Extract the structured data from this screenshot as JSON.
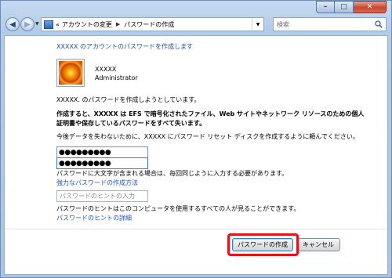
{
  "nav": {
    "breadcrumb_prefix": "«",
    "crumbs": [
      "アカウントの変更",
      "パスワードの作成"
    ],
    "search_placeholder": "検索"
  },
  "window_controls": {
    "minimize": "–",
    "maximize": "□",
    "close": "✕"
  },
  "content": {
    "title": "XXXXX のアカウントのパスワードを作成します",
    "user": {
      "name": "XXXXX",
      "role": "Administrator"
    },
    "intro": "XXXXX. のパスワードを作成しようとしています。",
    "warning": "作成すると、XXXXX は EFS で暗号化されたファイル、Web サイトやネットワーク リソースのための個人証明書や保存しているパスワードをすべて失います。",
    "advice": "今後データを失わないために、XXXXX にパスワード リセット ディスクを作成するように頼んでください。",
    "password_value": "●●●●●●●●●",
    "confirm_value": "●●●●●●●●●",
    "case_note": "パスワードに大文字が含まれる場合は、毎回同じように入力する必要があります。",
    "strong_password_link": "強力なパスワードの作成方法",
    "hint_placeholder": "パスワードのヒントの入力",
    "hint_note": "パスワードのヒントはこのコンピュータを使用するすべての人が見ることができます。",
    "hint_link": "パスワードのヒントの詳細"
  },
  "buttons": {
    "create": "パスワードの作成",
    "cancel": "キャンセル"
  },
  "colors": {
    "link": "#1a56c0",
    "title": "#1e4e9c",
    "highlight": "#e2141b"
  }
}
